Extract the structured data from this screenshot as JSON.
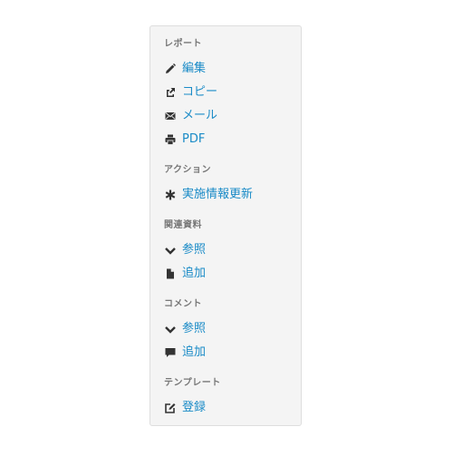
{
  "sections": {
    "report": {
      "title": "レポート",
      "items": [
        {
          "label": "編集",
          "icon": "pencil-icon"
        },
        {
          "label": "コピー",
          "icon": "share-icon"
        },
        {
          "label": "メール",
          "icon": "envelope-icon"
        },
        {
          "label": "PDF",
          "icon": "printer-icon"
        }
      ]
    },
    "action": {
      "title": "アクション",
      "items": [
        {
          "label": "実施情報更新",
          "icon": "asterisk-icon"
        }
      ]
    },
    "related": {
      "title": "関連資料",
      "items": [
        {
          "label": "参照",
          "icon": "chevron-down-icon"
        },
        {
          "label": "追加",
          "icon": "file-icon"
        }
      ]
    },
    "comment": {
      "title": "コメント",
      "items": [
        {
          "label": "参照",
          "icon": "chevron-down-icon"
        },
        {
          "label": "追加",
          "icon": "comment-icon"
        }
      ]
    },
    "template": {
      "title": "テンプレート",
      "items": [
        {
          "label": "登録",
          "icon": "edit-square-icon"
        }
      ]
    }
  },
  "colors": {
    "link": "#1a8bc7",
    "heading": "#777777",
    "icon": "#333333",
    "panel_bg": "#f4f4f4",
    "panel_border": "#dedede"
  }
}
